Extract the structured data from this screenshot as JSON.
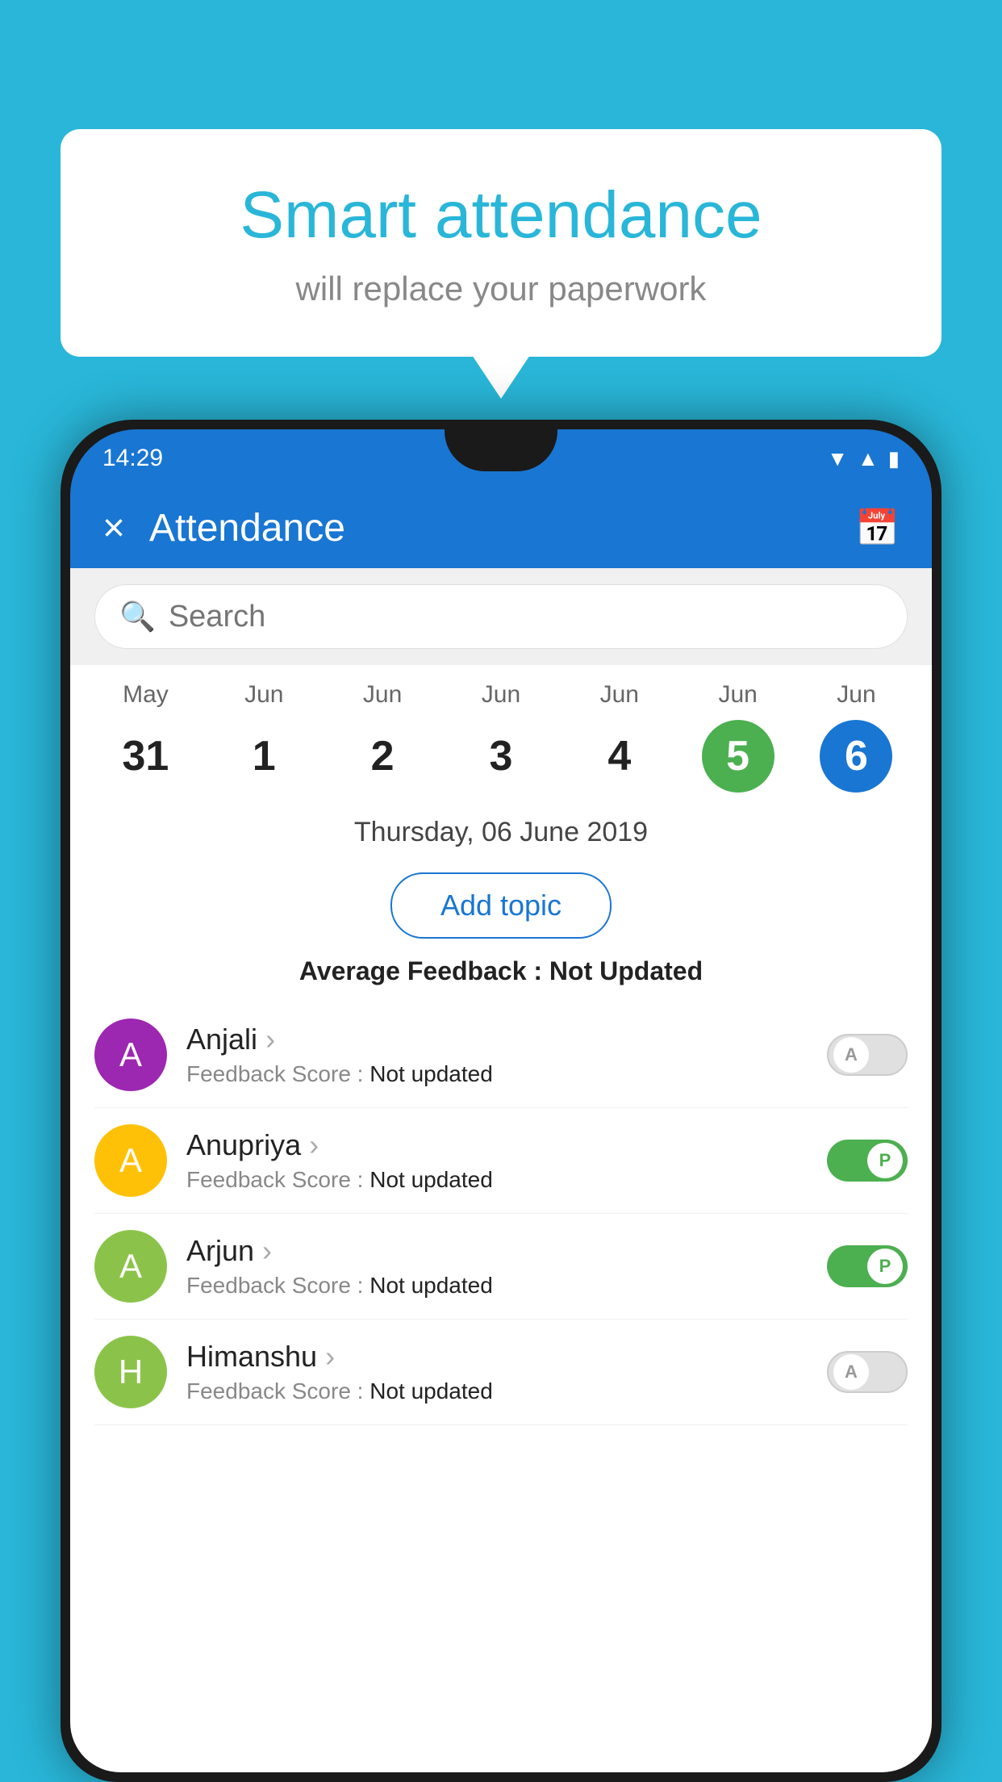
{
  "background_color": "#29B6D8",
  "bubble": {
    "title": "Smart attendance",
    "subtitle": "will replace your paperwork"
  },
  "status_bar": {
    "time": "14:29",
    "icons": [
      "wifi",
      "signal",
      "battery"
    ]
  },
  "app_bar": {
    "title": "Attendance",
    "close_label": "×",
    "calendar_icon": "📅"
  },
  "search": {
    "placeholder": "Search"
  },
  "calendar": {
    "days": [
      {
        "month": "May",
        "date": "31",
        "state": "normal"
      },
      {
        "month": "Jun",
        "date": "1",
        "state": "normal"
      },
      {
        "month": "Jun",
        "date": "2",
        "state": "normal"
      },
      {
        "month": "Jun",
        "date": "3",
        "state": "normal"
      },
      {
        "month": "Jun",
        "date": "4",
        "state": "normal"
      },
      {
        "month": "Jun",
        "date": "5",
        "state": "today"
      },
      {
        "month": "Jun",
        "date": "6",
        "state": "selected"
      }
    ]
  },
  "selected_date": "Thursday, 06 June 2019",
  "add_topic_label": "Add topic",
  "average_feedback": {
    "label": "Average Feedback : ",
    "value": "Not Updated"
  },
  "students": [
    {
      "name": "Anjali",
      "avatar_letter": "A",
      "avatar_color": "#9C27B0",
      "feedback_label": "Feedback Score : ",
      "feedback_value": "Not updated",
      "attendance": "absent",
      "toggle_label": "A"
    },
    {
      "name": "Anupriya",
      "avatar_letter": "A",
      "avatar_color": "#FFC107",
      "feedback_label": "Feedback Score : ",
      "feedback_value": "Not updated",
      "attendance": "present",
      "toggle_label": "P"
    },
    {
      "name": "Arjun",
      "avatar_letter": "A",
      "avatar_color": "#8BC34A",
      "feedback_label": "Feedback Score : ",
      "feedback_value": "Not updated",
      "attendance": "present",
      "toggle_label": "P"
    },
    {
      "name": "Himanshu",
      "avatar_letter": "H",
      "avatar_color": "#8BC34A",
      "feedback_label": "Feedback Score : ",
      "feedback_value": "Not updated",
      "attendance": "absent",
      "toggle_label": "A"
    }
  ]
}
